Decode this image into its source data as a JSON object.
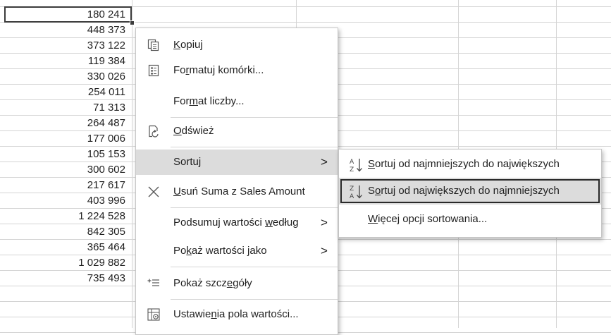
{
  "cells": [
    "180 241",
    "448 373",
    "373 122",
    "119 384",
    "330 026",
    "254 011",
    "71 313",
    "264 487",
    "177 006",
    "105 153",
    "300 602",
    "217 617",
    "403 996",
    "1 224 528",
    "842 305",
    "365 464",
    "1 029 882",
    "735 493"
  ],
  "menu": {
    "copy": {
      "pre": "",
      "key": "K",
      "post": "opiuj"
    },
    "format_cells": {
      "pre": "Fo",
      "key": "r",
      "post": "matuj komórki..."
    },
    "number_format": {
      "pre": "For",
      "key": "m",
      "post": "at liczby..."
    },
    "refresh": {
      "pre": "",
      "key": "O",
      "post": "dśwież"
    },
    "sort": {
      "pre": "Sortu",
      "key": "j",
      "post": ""
    },
    "remove": {
      "pre": "",
      "key": "U",
      "post": "suń Suma z Sales Amount"
    },
    "summarize": {
      "pre": "Podsumuj wartości ",
      "key": "w",
      "post": "edług"
    },
    "show_values": {
      "pre": "Po",
      "key": "k",
      "post": "aż wartości jako"
    },
    "show_details": {
      "pre": "Pokaż szcz",
      "key": "e",
      "post": "góły"
    },
    "value_field": {
      "pre": "Ustawie",
      "key": "n",
      "post": "ia pola wartości..."
    },
    "arrow": ">"
  },
  "submenu": {
    "asc": {
      "pre": "",
      "key": "S",
      "post": "ortuj od najmniejszych do największych"
    },
    "desc": {
      "pre": "S",
      "key": "o",
      "post": "rtuj od największych do najmniejszych"
    },
    "more": {
      "pre": "",
      "key": "W",
      "post": "ięcej opcji sortowania..."
    }
  },
  "colors": {
    "highlight": "#dcdcdc",
    "gridline": "#d4d4d4",
    "text": "#1f1f1f"
  }
}
